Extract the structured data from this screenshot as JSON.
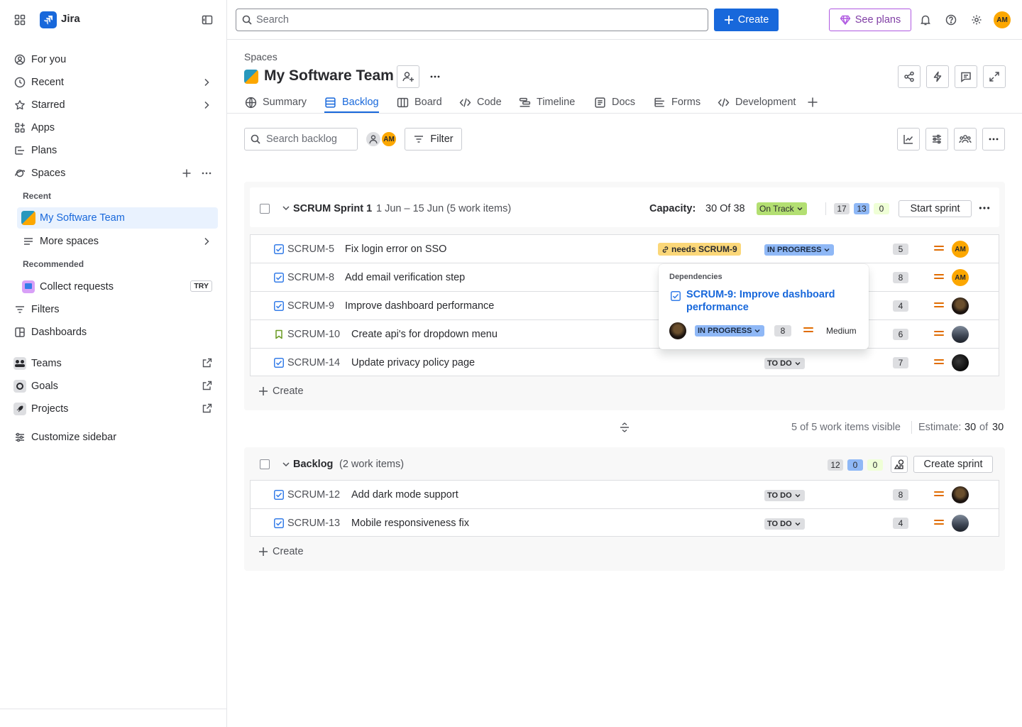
{
  "app": {
    "brand": "Jira"
  },
  "sidebar": {
    "items": [
      {
        "label": "For you"
      },
      {
        "label": "Recent"
      },
      {
        "label": "Starred"
      },
      {
        "label": "Apps"
      },
      {
        "label": "Plans"
      },
      {
        "label": "Spaces"
      }
    ],
    "recent_section": "Recent",
    "recent_space": "My Software Team",
    "more_spaces": "More spaces",
    "recommended_section": "Recommended",
    "collect_requests": "Collect requests",
    "try_badge": "TRY",
    "filters": "Filters",
    "dashboards": "Dashboards",
    "teams": "Teams",
    "goals": "Goals",
    "projects": "Projects",
    "customize": "Customize sidebar"
  },
  "topbar": {
    "search_placeholder": "Search",
    "create_label": "Create",
    "plans_label": "See plans",
    "avatar_initials": "AM"
  },
  "header": {
    "breadcrumb": "Spaces",
    "title": "My Software Team"
  },
  "tabs": [
    {
      "label": "Summary"
    },
    {
      "label": "Backlog"
    },
    {
      "label": "Board"
    },
    {
      "label": "Code"
    },
    {
      "label": "Timeline"
    },
    {
      "label": "Docs"
    },
    {
      "label": "Forms"
    },
    {
      "label": "Development"
    }
  ],
  "toolbar": {
    "search_placeholder": "Search backlog",
    "avatar_initials": "AM",
    "filter_label": "Filter"
  },
  "sprint": {
    "name": "SCRUM Sprint 1",
    "dates": "1 Jun – 15 Jun (5 work items)",
    "capacity_label": "Capacity:",
    "capacity_value": "30 Of 38",
    "track_label": "On Track",
    "counts": [
      "17",
      "13",
      "0"
    ],
    "start_label": "Start sprint",
    "create_label": "Create",
    "rows": [
      {
        "key": "SCRUM-5",
        "summary": "Fix login error on SSO",
        "dependency": "needs SCRUM-9",
        "status": "IN PROGRESS",
        "estimate": "5",
        "assignee": "AM"
      },
      {
        "key": "SCRUM-8",
        "summary": "Add email verification step",
        "status": "",
        "estimate": "8",
        "assignee": "AM"
      },
      {
        "key": "SCRUM-9",
        "summary": "Improve dashboard performance",
        "status": "",
        "estimate": "4",
        "assignee": ""
      },
      {
        "key": "SCRUM-10",
        "summary": "Create api's for dropdown menu",
        "status": "",
        "estimate": "6",
        "assignee": ""
      },
      {
        "key": "SCRUM-14",
        "summary": "Update privacy policy page",
        "status": "TO DO",
        "estimate": "7",
        "assignee": ""
      }
    ]
  },
  "visibility": {
    "visible_text": "5 of 5 work items visible",
    "estimate_label": "Estimate:",
    "estimate_value": "30",
    "estimate_of": "of",
    "estimate_total": "30"
  },
  "backlog": {
    "name": "Backlog",
    "count": "(2 work items)",
    "counts": [
      "12",
      "0",
      "0"
    ],
    "create_sprint_label": "Create sprint",
    "create_label": "Create",
    "rows": [
      {
        "key": "SCRUM-12",
        "summary": "Add dark mode support",
        "status": "TO DO",
        "estimate": "8"
      },
      {
        "key": "SCRUM-13",
        "summary": "Mobile responsiveness fix",
        "status": "TO DO",
        "estimate": "4"
      }
    ]
  },
  "popover": {
    "heading": "Dependencies",
    "link": "SCRUM-9: Improve dashboard performance",
    "status": "IN PROGRESS",
    "estimate": "8",
    "priority": "Medium"
  },
  "colors": {
    "accent": "#1868db",
    "avatar_orange": "#fca700",
    "priority_orange": "#e06c00",
    "in_progress": "#8fb8f6",
    "on_track": "#b3df72",
    "dependency": "#fbd779"
  }
}
